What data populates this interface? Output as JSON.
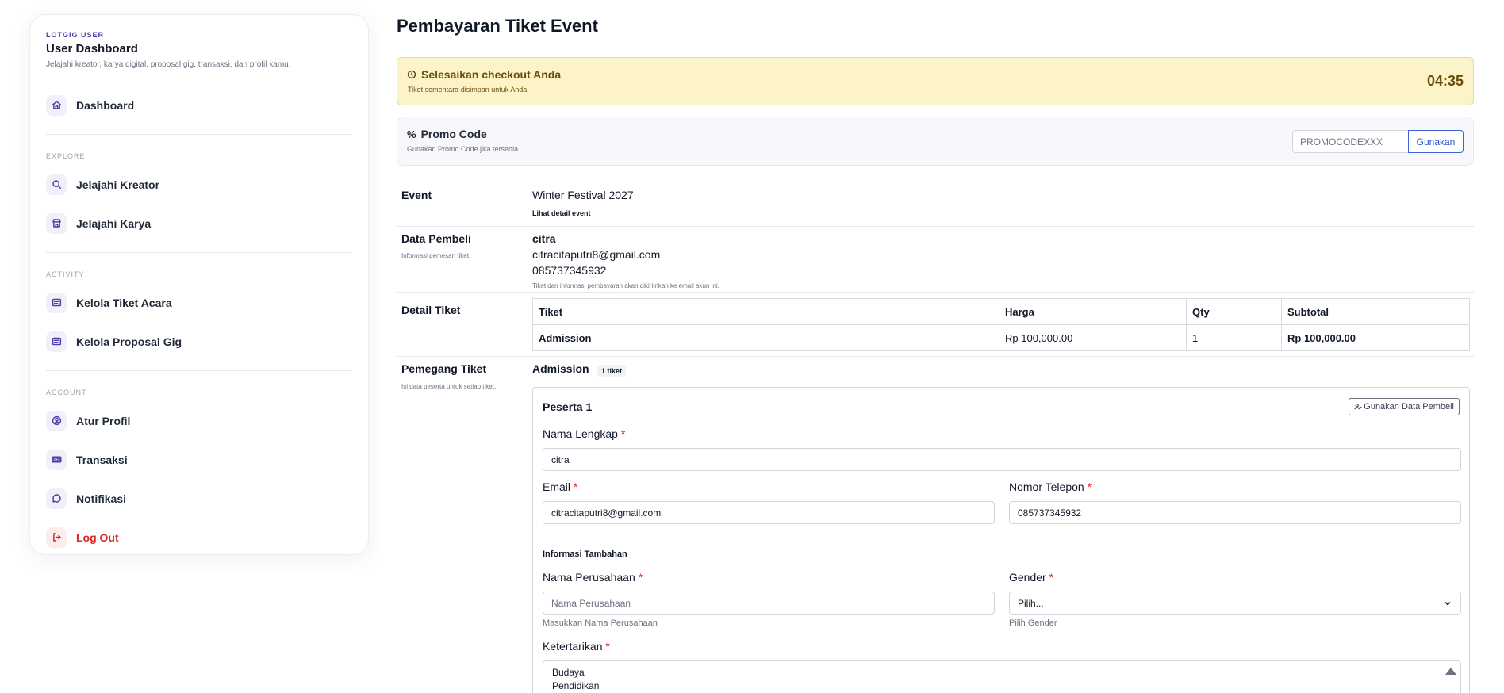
{
  "sidebar": {
    "eyebrow": "LOTGIG USER",
    "title": "User Dashboard",
    "description": "Jelajahi kreator, karya digital, proposal gig, transaksi, dan profil kamu.",
    "dashboard_label": "Dashboard",
    "explore_title": "EXPLORE",
    "explore_items": [
      {
        "label": "Jelajahi Kreator",
        "icon": "search-icon"
      },
      {
        "label": "Jelajahi Karya",
        "icon": "store-icon"
      }
    ],
    "activity_title": "ACTIVITY",
    "activity_items": [
      {
        "label": "Kelola Tiket Acara",
        "icon": "ticket-list-icon"
      },
      {
        "label": "Kelola Proposal Gig",
        "icon": "proposal-list-icon"
      }
    ],
    "account_title": "ACCOUNT",
    "account_items": [
      {
        "label": "Atur Profil",
        "icon": "user-circle-icon"
      },
      {
        "label": "Transaksi",
        "icon": "money-icon"
      },
      {
        "label": "Notifikasi",
        "icon": "chat-icon"
      }
    ],
    "logout_label": "Log Out"
  },
  "page": {
    "title": "Pembayaran Tiket Event"
  },
  "checkout_alert": {
    "title": "Selesaikan checkout Anda",
    "subtitle": "Tiket sementara disimpan untuk Anda.",
    "timer": "04:35"
  },
  "promo": {
    "icon_glyph": "%",
    "title": "Promo Code",
    "subtitle": "Gunakan Promo Code jika tersedia.",
    "placeholder": "PROMOCODEXXX",
    "button": "Gunakan"
  },
  "event": {
    "label": "Event",
    "name": "Winter Festival 2027",
    "link": "Lihat detail event"
  },
  "buyer": {
    "label": "Data Pembeli",
    "hint": "Informasi pemesan tiket.",
    "name": "citra",
    "email": "citracitaputri8@gmail.com",
    "phone": "085737345932",
    "note": "Tiket dan informasi pembayaran akan dikirimkan ke email akun ini."
  },
  "ticket_detail": {
    "label": "Detail Tiket",
    "columns": [
      "Tiket",
      "Harga",
      "Qty",
      "Subtotal"
    ],
    "rows": [
      {
        "ticket": "Admission",
        "price": "Rp 100,000.00",
        "qty": "1",
        "subtotal": "Rp 100,000.00"
      }
    ]
  },
  "holder": {
    "label": "Pemegang Tiket",
    "hint": "Isi data peserta untuk setiap tiket.",
    "ticket_type": "Admission",
    "badge": "1 tiket",
    "participant_title": "Peserta 1",
    "use_buyer_button": "Gunakan Data Pembeli",
    "full_name_label": "Nama Lengkap",
    "full_name_value": "citra",
    "email_label": "Email",
    "email_value": "citracitaputri8@gmail.com",
    "phone_label": "Nomor Telepon",
    "phone_value": "085737345932",
    "extra_title": "Informasi Tambahan",
    "company_label": "Nama Perusahaan",
    "company_placeholder": "Nama Perusahaan",
    "company_hint": "Masukkan Nama Perusahaan",
    "gender_label": "Gender",
    "gender_selected": "Pilih...",
    "gender_hint": "Pilih Gender",
    "interest_label": "Ketertarikan",
    "interest_options": [
      "Budaya",
      "Pendidikan"
    ],
    "required_mark": "*"
  }
}
